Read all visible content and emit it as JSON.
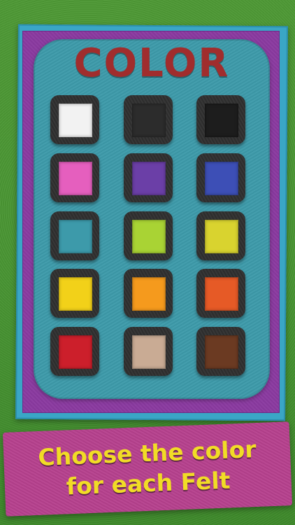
{
  "title": "COLOR",
  "caption": {
    "line1": "Choose the color",
    "line2": "for each Felt"
  },
  "swatches": [
    {
      "row": 1,
      "col": 1,
      "color": "#f2f2f2"
    },
    {
      "row": 1,
      "col": 2,
      "color": "#2c2c2c"
    },
    {
      "row": 1,
      "col": 3,
      "color": "#1d1d1d"
    },
    {
      "row": 2,
      "col": 1,
      "color": "#e55fbe"
    },
    {
      "row": 2,
      "col": 2,
      "color": "#6b3fa7"
    },
    {
      "row": 2,
      "col": 3,
      "color": "#3d4fb6"
    },
    {
      "row": 3,
      "col": 1,
      "color": "#3d9aaa"
    },
    {
      "row": 3,
      "col": 2,
      "color": "#a9d334"
    },
    {
      "row": 3,
      "col": 3,
      "color": "#d9d32f"
    },
    {
      "row": 4,
      "col": 1,
      "color": "#f2d119"
    },
    {
      "row": 4,
      "col": 2,
      "color": "#f59a1d"
    },
    {
      "row": 4,
      "col": 3,
      "color": "#e65a26"
    },
    {
      "row": 5,
      "col": 1,
      "color": "#cc1f2b"
    },
    {
      "row": 5,
      "col": 2,
      "color": "#c9ab94"
    },
    {
      "row": 5,
      "col": 3,
      "color": "#6b3a22"
    }
  ]
}
